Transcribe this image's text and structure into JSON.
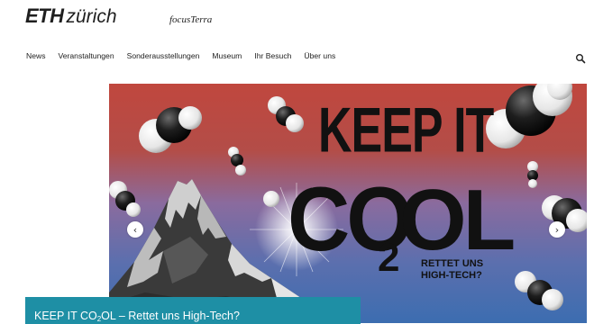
{
  "header": {
    "logo_eth": "ETH",
    "logo_zurich": "zürich",
    "site_name": "focusTerra"
  },
  "nav": {
    "items": [
      {
        "label": "News"
      },
      {
        "label": "Veranstaltungen"
      },
      {
        "label": "Sonderausstellungen"
      },
      {
        "label": "Museum"
      },
      {
        "label": "Ihr Besuch"
      },
      {
        "label": "Über uns"
      }
    ],
    "search_icon": "search-icon"
  },
  "hero": {
    "line1": "KEEP IT",
    "co": "CO",
    "sub2": "2",
    "ol": "OL",
    "tagline1": "RETTET UNS",
    "tagline2": "HIGH-TECH?",
    "colors": {
      "top": "#c4504a",
      "mid": "#7c6fa6",
      "bottom": "#3e6fb0"
    }
  },
  "caption": {
    "prefix": "KEEP IT CO",
    "sub": "2",
    "suffix": "OL – Rettet uns High-Tech?"
  },
  "controls": {
    "prev_icon": "chevron-left-icon",
    "next_icon": "chevron-right-icon"
  }
}
